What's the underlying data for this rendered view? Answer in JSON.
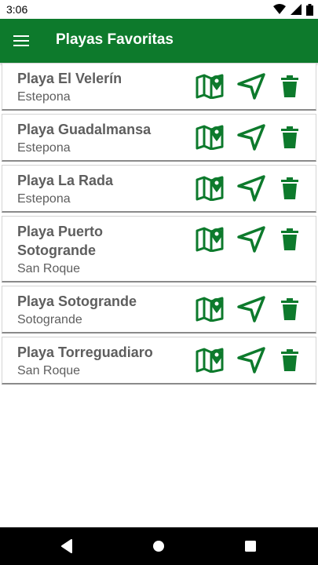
{
  "status_bar": {
    "time": "3:06"
  },
  "app_bar": {
    "title": "Playas Favoritas",
    "menu_icon": "menu-icon"
  },
  "colors": {
    "primary": "#0d7a2c",
    "text": "#5e5e5e"
  },
  "beaches": [
    {
      "name": "Playa El Velerín",
      "town": "Estepona"
    },
    {
      "name": "Playa Guadalmansa",
      "town": "Estepona"
    },
    {
      "name": "Playa La Rada",
      "town": "Estepona"
    },
    {
      "name": "Playa Puerto Sotogrande",
      "town": "San Roque"
    },
    {
      "name": "Playa Sotogrande",
      "town": "Sotogrande"
    },
    {
      "name": "Playa Torreguadiaro",
      "town": "San Roque"
    }
  ],
  "row_actions": [
    "map-icon",
    "navigate-icon",
    "delete-icon"
  ],
  "nav_bar": [
    "back-icon",
    "home-icon",
    "recents-icon"
  ]
}
